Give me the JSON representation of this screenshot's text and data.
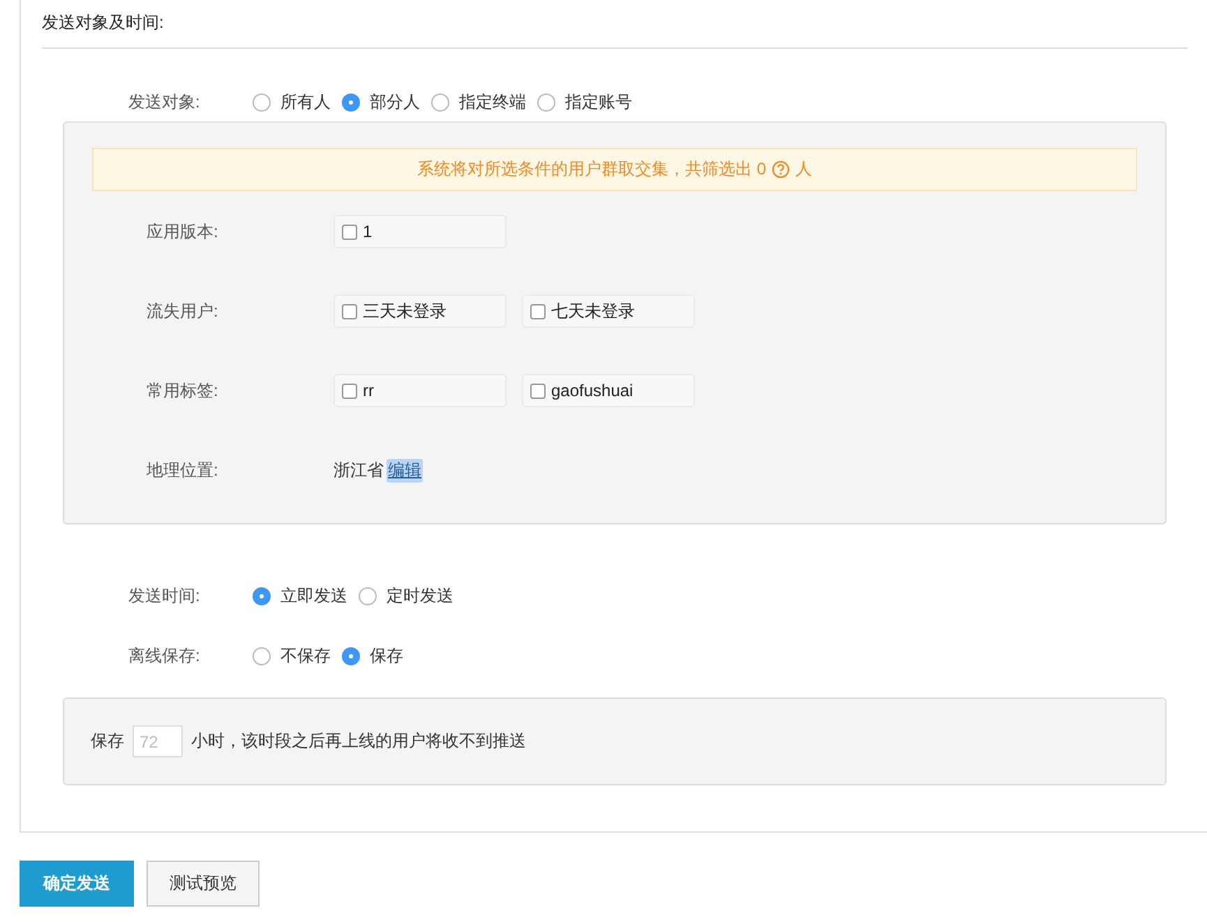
{
  "section_title": "发送对象及时间:",
  "target": {
    "label": "发送对象:",
    "options": [
      {
        "label": "所有人",
        "selected": false
      },
      {
        "label": "部分人",
        "selected": true
      },
      {
        "label": "指定终端",
        "selected": false
      },
      {
        "label": "指定账号",
        "selected": false
      }
    ]
  },
  "notice": {
    "text_before": "系统将对所选条件的用户群取交集，共筛选出 0",
    "text_after": "人"
  },
  "filters": [
    {
      "label": "应用版本:",
      "kind": "checkboxes",
      "options": [
        {
          "label": "1",
          "checked": false
        }
      ]
    },
    {
      "label": "流失用户:",
      "kind": "checkboxes",
      "options": [
        {
          "label": "三天未登录",
          "checked": false
        },
        {
          "label": "七天未登录",
          "checked": false
        }
      ]
    },
    {
      "label": "常用标签:",
      "kind": "checkboxes",
      "options": [
        {
          "label": "rr",
          "checked": false
        },
        {
          "label": "gaofushuai",
          "checked": false
        }
      ]
    },
    {
      "label": "地理位置:",
      "kind": "location",
      "value": "浙江省",
      "link": "编辑"
    }
  ],
  "send_time": {
    "label": "发送时间:",
    "options": [
      {
        "label": "立即发送",
        "selected": true
      },
      {
        "label": "定时发送",
        "selected": false
      }
    ]
  },
  "offline": {
    "label": "离线保存:",
    "options": [
      {
        "label": "不保存",
        "selected": false
      },
      {
        "label": "保存",
        "selected": true
      }
    ]
  },
  "retention": {
    "prefix": "保存",
    "placeholder": "72",
    "suffix": "小时，该时段之后再上线的用户将收不到推送"
  },
  "buttons": [
    {
      "label": "确定发送",
      "kind": "primary"
    },
    {
      "label": "测试预览",
      "kind": "default"
    }
  ]
}
